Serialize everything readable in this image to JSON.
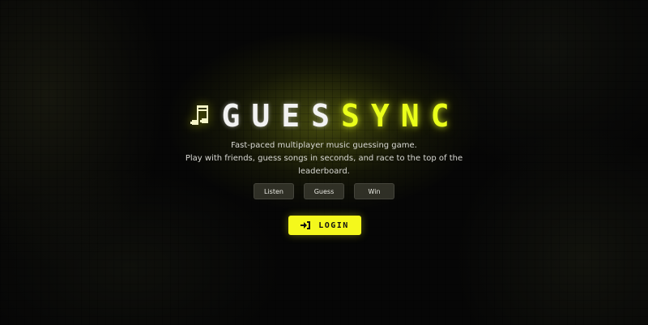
{
  "brand": {
    "logo_part1": "GUES",
    "logo_part2": "SYNC",
    "accent_color": "#eaff1a",
    "icon": "music-note-icon"
  },
  "tagline": {
    "line1": "Fast-paced multiplayer music guessing game.",
    "line2": "Play with friends, guess songs in seconds, and race to the top of the",
    "line3": "leaderboard."
  },
  "steps": [
    {
      "label": "Listen"
    },
    {
      "label": "Guess"
    },
    {
      "label": "Win"
    }
  ],
  "login": {
    "label": "LOGIN",
    "icon": "sign-in-icon",
    "color": "#f4f81c"
  }
}
